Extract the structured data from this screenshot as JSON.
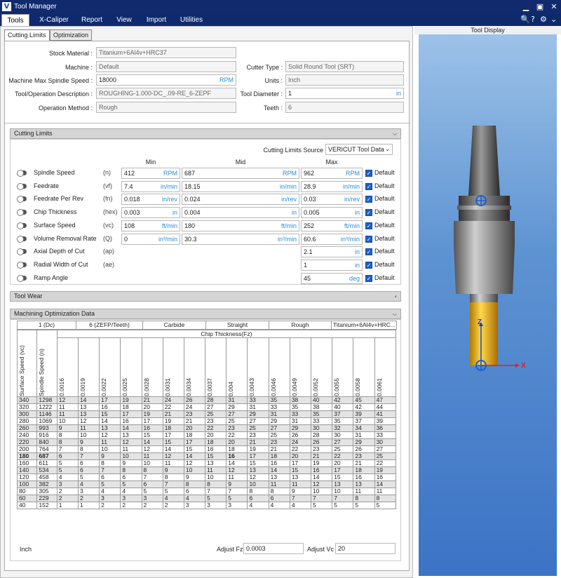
{
  "window": {
    "title": "Tool Manager",
    "logo": "V",
    "buttons": [
      "minimize-icon",
      "maximize-icon",
      "close-icon"
    ]
  },
  "menu": {
    "items": [
      "Tools",
      "X-Caliper",
      "Report",
      "View",
      "Import",
      "Utilities"
    ],
    "icons": [
      "🔍",
      "?",
      "⚙",
      "⌄"
    ]
  },
  "tabs": [
    "Cutting Limits",
    "Optimization"
  ],
  "form": {
    "stock_material_label": "Stock Material :",
    "stock_material": "Titanium+6Al4v+HRC37",
    "machine_label": "Machine :",
    "machine": "Default",
    "spindle_label": "Machine Max Spindle Speed :",
    "spindle": "18000",
    "spindle_unit": "RPM",
    "desc_label": "Tool/Operation Description :",
    "desc": "ROUGHING-1.000-DC_.09-RE_6-ZEPF",
    "method_label": "Operation Method :",
    "method": "Rough",
    "cutter_type_label": "Cutter Type :",
    "cutter_type": "Solid Round Tool (SRT)",
    "units_label": "Units :",
    "units": "Inch",
    "diameter_label": "Tool Diameter :",
    "diameter": "1",
    "diameter_unit": "in",
    "teeth_label": "Teeth :",
    "teeth": "6"
  },
  "cutting_limits": {
    "title": "Cutting Limits",
    "source_label": "Cutting Limits Source",
    "source": "VERICUT Tool Data",
    "col_min": "Min",
    "col_mid": "Mid",
    "col_max": "Max",
    "default_label": "Default",
    "rows": [
      {
        "name": "Spindle Speed",
        "sym": "(n)",
        "min": "412",
        "min_u": "RPM",
        "mid": "687",
        "mid_u": "RPM",
        "max": "962",
        "max_u": "RPM"
      },
      {
        "name": "Feedrate",
        "sym": "(vf)",
        "min": "7.4",
        "min_u": "in/min",
        "mid": "18.15",
        "mid_u": "in/min",
        "max": "28.9",
        "max_u": "in/min"
      },
      {
        "name": "Feedrate Per Rev",
        "sym": "(fn)",
        "min": "0.018",
        "min_u": "in/rev",
        "mid": "0.024",
        "mid_u": "in/rev",
        "max": "0.03",
        "max_u": "in/rev"
      },
      {
        "name": "Chip Thickness",
        "sym": "(hex)",
        "min": "0.003",
        "min_u": "in",
        "mid": "0.004",
        "mid_u": "in",
        "max": "0.005",
        "max_u": "in"
      },
      {
        "name": "Surface Speed",
        "sym": "(vc)",
        "min": "108",
        "min_u": "ft/min",
        "mid": "180",
        "mid_u": "ft/min",
        "max": "252",
        "max_u": "ft/min"
      },
      {
        "name": "Volume Removal Rate",
        "sym": "(Q)",
        "min": "0",
        "min_u": "in³/min",
        "mid": "30.3",
        "mid_u": "in³/min",
        "max": "60.6",
        "max_u": "in³/min"
      },
      {
        "name": "Axial Depth of Cut",
        "sym": "(ap)",
        "min": "",
        "min_u": "",
        "mid": "",
        "mid_u": "",
        "max": "2.1",
        "max_u": "in"
      },
      {
        "name": "Radial Width of Cut",
        "sym": "(ae)",
        "min": "",
        "min_u": "",
        "mid": "",
        "mid_u": "",
        "max": "1",
        "max_u": "in"
      },
      {
        "name": "Ramp Angle",
        "sym": "",
        "min": "",
        "min_u": "",
        "mid": "",
        "mid_u": "",
        "max": "45",
        "max_u": "deg"
      }
    ]
  },
  "tool_wear": {
    "title": "Tool Wear"
  },
  "mod": {
    "title": "Machining Optimization Data",
    "header": [
      "1 (Dc)",
      "6 (ZEFP/Teeth)",
      "Carbide",
      "Straight",
      "Rough",
      "Titanium+6Al4v+HRC..."
    ],
    "chip_label": "Chip Thickness(Fz)",
    "col_sv": "Surface Speed (vc)",
    "col_sp": "Spindle Speed (n)",
    "fz": [
      "0.0016",
      "0.0019",
      "0.0022",
      "0.0025",
      "0.0028",
      "0.0031",
      "0.0034",
      "0.0037",
      "0.004",
      "0.0043",
      "0.0046",
      "0.0049",
      "0.0052",
      "0.0055",
      "0.0058",
      "0.0061"
    ],
    "rows": [
      {
        "sv": "340",
        "sp": "1298",
        "v": [
          "12",
          "14",
          "17",
          "19",
          "21",
          "24",
          "26",
          "28",
          "31",
          "33",
          "35",
          "38",
          "40",
          "42",
          "45",
          "47"
        ]
      },
      {
        "sv": "320",
        "sp": "1222",
        "v": [
          "11",
          "13",
          "16",
          "18",
          "20",
          "22",
          "24",
          "27",
          "29",
          "31",
          "33",
          "35",
          "38",
          "40",
          "42",
          "44"
        ]
      },
      {
        "sv": "300",
        "sp": "1146",
        "v": [
          "11",
          "13",
          "15",
          "17",
          "19",
          "21",
          "23",
          "25",
          "27",
          "29",
          "31",
          "33",
          "35",
          "37",
          "39",
          "41"
        ]
      },
      {
        "sv": "280",
        "sp": "1069",
        "v": [
          "10",
          "12",
          "14",
          "16",
          "17",
          "19",
          "21",
          "23",
          "25",
          "27",
          "29",
          "31",
          "33",
          "35",
          "37",
          "39"
        ]
      },
      {
        "sv": "260",
        "sp": "993",
        "v": [
          "9",
          "11",
          "13",
          "14",
          "16",
          "18",
          "20",
          "22",
          "23",
          "25",
          "27",
          "29",
          "30",
          "32",
          "34",
          "36"
        ]
      },
      {
        "sv": "240",
        "sp": "916",
        "v": [
          "8",
          "10",
          "12",
          "13",
          "15",
          "17",
          "18",
          "20",
          "22",
          "23",
          "25",
          "26",
          "28",
          "30",
          "31",
          "33"
        ]
      },
      {
        "sv": "220",
        "sp": "840",
        "v": [
          "8",
          "9",
          "11",
          "12",
          "14",
          "15",
          "17",
          "18",
          "20",
          "21",
          "23",
          "24",
          "26",
          "27",
          "29",
          "30"
        ]
      },
      {
        "sv": "200",
        "sp": "764",
        "v": [
          "7",
          "8",
          "10",
          "11",
          "12",
          "14",
          "15",
          "16",
          "18",
          "19",
          "21",
          "22",
          "23",
          "25",
          "26",
          "27"
        ]
      },
      {
        "sv": "180",
        "sp": "687",
        "v": [
          "6",
          "7",
          "9",
          "10",
          "11",
          "12",
          "14",
          "15",
          "16",
          "17",
          "18",
          "20",
          "21",
          "22",
          "23",
          "25"
        ]
      },
      {
        "sv": "160",
        "sp": "611",
        "v": [
          "5",
          "6",
          "8",
          "9",
          "10",
          "11",
          "12",
          "13",
          "14",
          "15",
          "16",
          "17",
          "19",
          "20",
          "21",
          "22"
        ]
      },
      {
        "sv": "140",
        "sp": "534",
        "v": [
          "5",
          "6",
          "7",
          "8",
          "8",
          "9",
          "10",
          "11",
          "12",
          "13",
          "14",
          "15",
          "16",
          "17",
          "18",
          "19"
        ]
      },
      {
        "sv": "120",
        "sp": "458",
        "v": [
          "4",
          "5",
          "6",
          "6",
          "7",
          "8",
          "9",
          "10",
          "11",
          "12",
          "13",
          "13",
          "14",
          "15",
          "16",
          "16"
        ]
      },
      {
        "sv": "100",
        "sp": "382",
        "v": [
          "3",
          "4",
          "5",
          "5",
          "6",
          "7",
          "8",
          "8",
          "9",
          "10",
          "11",
          "11",
          "12",
          "13",
          "13",
          "14"
        ]
      },
      {
        "sv": "80",
        "sp": "305",
        "v": [
          "2",
          "3",
          "4",
          "4",
          "5",
          "5",
          "6",
          "7",
          "7",
          "8",
          "8",
          "9",
          "10",
          "10",
          "11",
          "11"
        ]
      },
      {
        "sv": "60",
        "sp": "229",
        "v": [
          "2",
          "2",
          "3",
          "3",
          "3",
          "4",
          "4",
          "5",
          "5",
          "6",
          "6",
          "7",
          "7",
          "7",
          "8",
          "8"
        ]
      },
      {
        "sv": "40",
        "sp": "152",
        "v": [
          "1",
          "1",
          "2",
          "2",
          "2",
          "2",
          "3",
          "3",
          "3",
          "4",
          "4",
          "4",
          "5",
          "5",
          "5",
          "5"
        ]
      }
    ],
    "units": "Inch",
    "adj_fz_label": "Adjust Fz",
    "adj_fz": "0.0003",
    "adj_vc_label": "Adjust Vc",
    "adj_vc": "20"
  },
  "tool_display": {
    "title": "Tool Display",
    "axis_z": "Z",
    "axis_x": "X"
  }
}
